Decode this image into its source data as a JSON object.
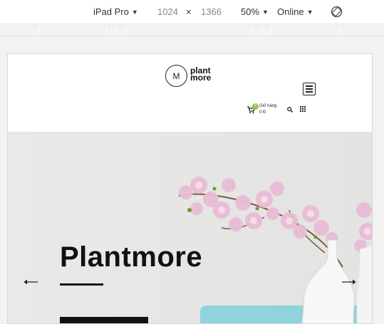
{
  "devtools": {
    "device": "iPad Pro",
    "width": "1024",
    "times": "×",
    "height": "1366",
    "zoom": "50%",
    "network": "Online",
    "caret": "▼"
  },
  "site": {
    "logo_mark": "M",
    "logo_line1": "plant",
    "logo_line2": "more",
    "cart_badge": "0",
    "cart_label": "Giỏ hàng",
    "cart_total": "0 Đ"
  },
  "hero": {
    "title": "Plantmore"
  },
  "colors": {
    "accent_green": "#8cc63f",
    "hero_bg": "#e7e7e5",
    "text_dark": "#111111"
  }
}
